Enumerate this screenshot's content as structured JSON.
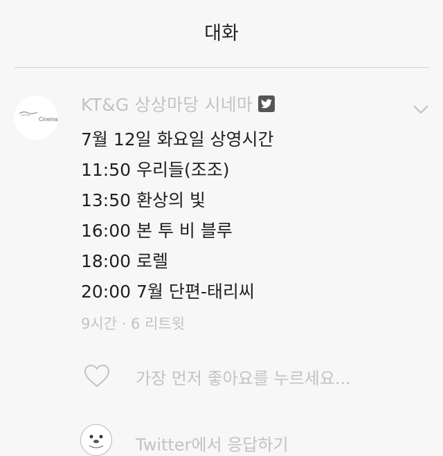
{
  "header": {
    "title": "대화"
  },
  "tweet": {
    "author": "KT&G 상상마당 시네마",
    "avatar_logo_text": "Cinema",
    "lines": [
      "7월 12일 화요일 상영시간",
      "11:50 우리들(조조)",
      "13:50 환상의 빛",
      "16:00 본 투 비 블루",
      "18:00 로렐",
      "20:00 7월 단편-태리씨"
    ],
    "meta": "9시간 · 6 리트윗"
  },
  "actions": {
    "like_prompt": "가장 먼저 좋아요를 누르세요...",
    "reply_prompt": "Twitter에서 응답하기"
  },
  "colors": {
    "background": "#f7f7f7",
    "muted_text": "#c2c2c2",
    "body_text": "#1f1f1f"
  }
}
